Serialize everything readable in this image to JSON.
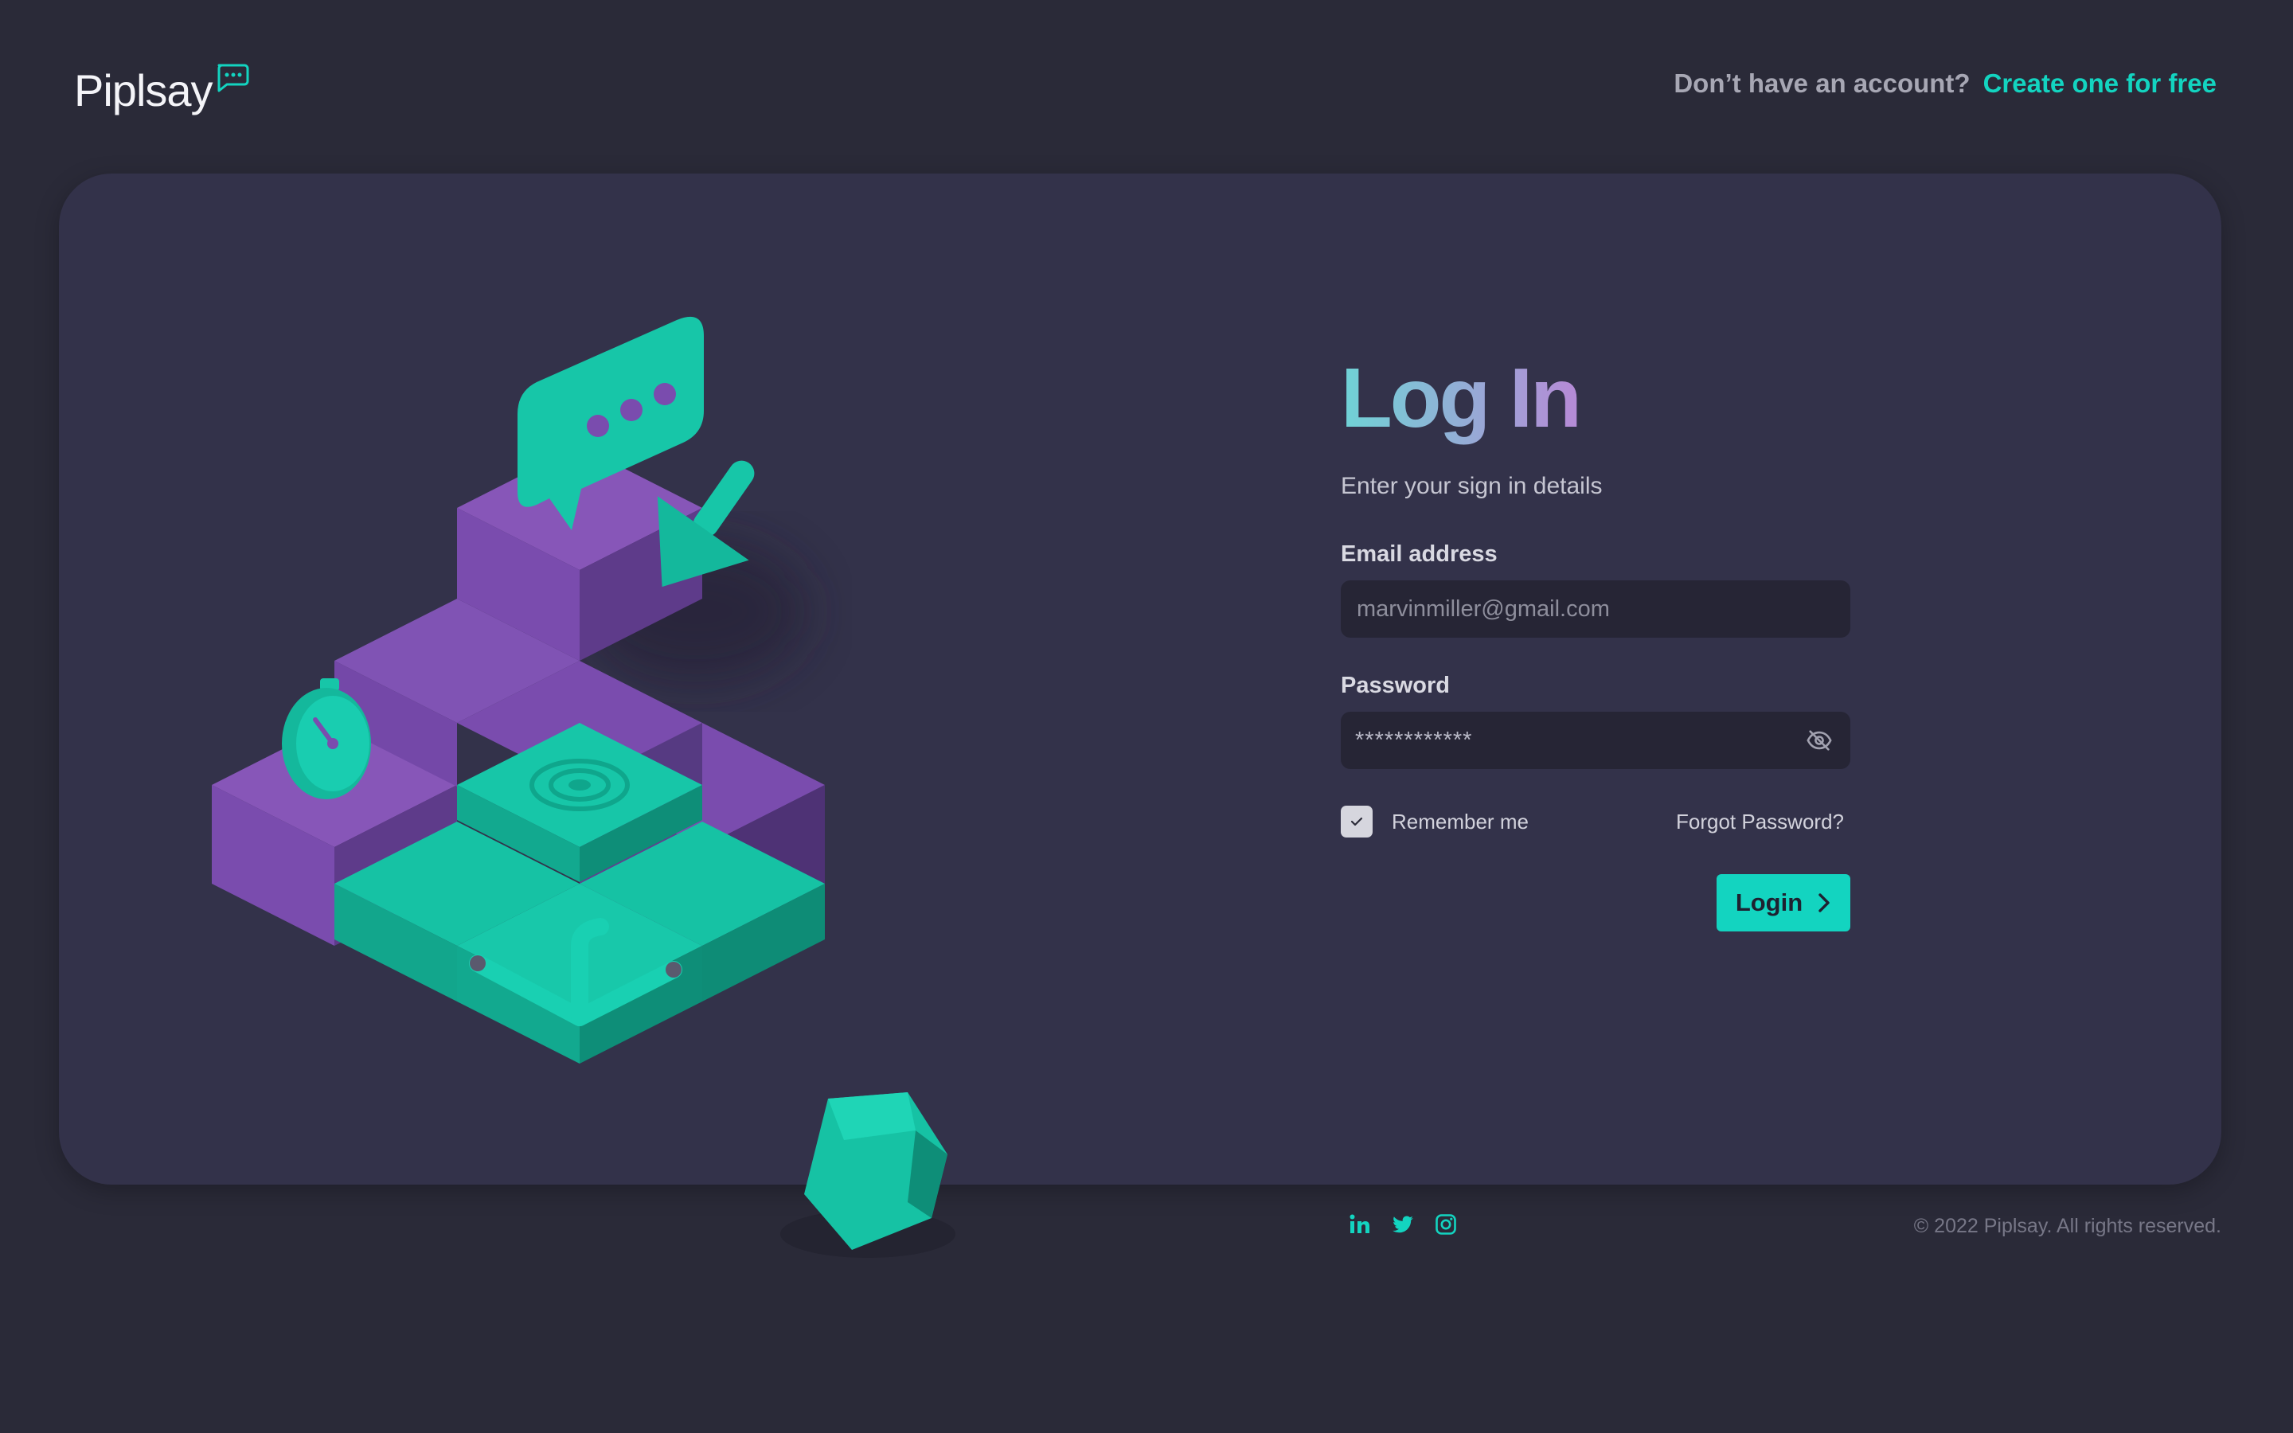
{
  "header": {
    "brand": "Piplsay",
    "signup_prompt": "Don’t have an account?",
    "signup_link": "Create one for free"
  },
  "login": {
    "title": "Log In",
    "subtitle": "Enter your sign in details",
    "email_label": "Email address",
    "email_placeholder": "marvinmiller@gmail.com",
    "password_label": "Password",
    "password_masked": "************",
    "remember_label": "Remember me",
    "remember_checked": true,
    "forgot_label": "Forgot Password?",
    "login_button": "Login"
  },
  "footer": {
    "social_icons": [
      "linkedin-icon",
      "twitter-icon",
      "instagram-icon"
    ],
    "copyright": "© 2022 Piplsay. All rights reserved."
  },
  "colors": {
    "background": "#2a2a38",
    "card": "#33324a",
    "accent": "#13d4c0",
    "purple": "#7a4db0",
    "input_bg": "#262535"
  }
}
